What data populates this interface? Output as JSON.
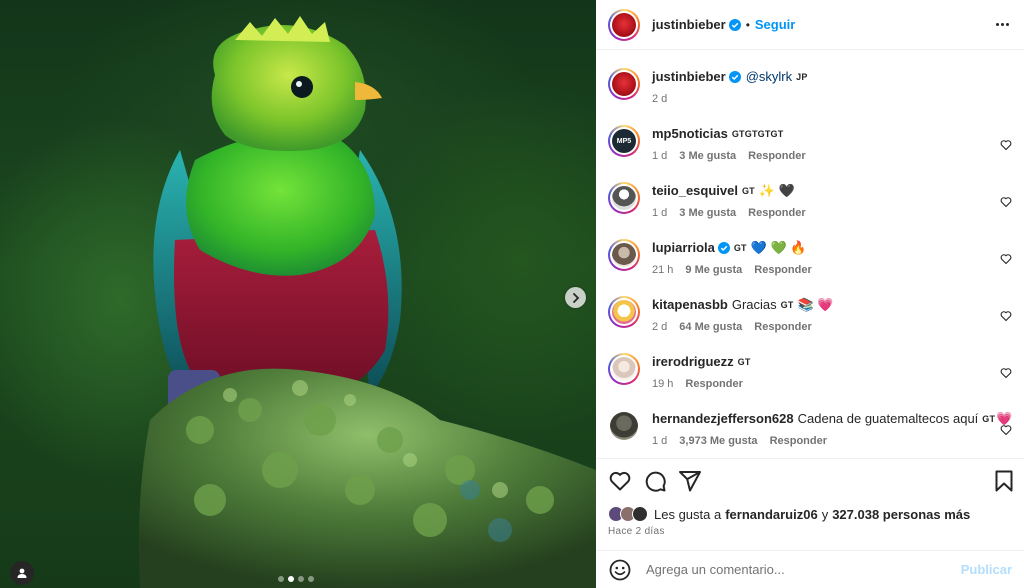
{
  "post": {
    "author": "justinbieber",
    "follow_label": "Seguir",
    "separator": "•",
    "caption_mention": "@skylrk",
    "caption_flag": "JP",
    "caption_time": "2 d"
  },
  "media": {
    "carousel": {
      "slides": 4,
      "active_index": 1
    }
  },
  "comments": [
    {
      "user": "mp5noticias",
      "text": "",
      "flag": "GTGTGTGT",
      "time": "1 d",
      "likes": "3 Me gusta",
      "reply": "Responder",
      "verified": false,
      "avatar": "logo"
    },
    {
      "user": "teiio_esquivel",
      "text": "",
      "flag": "GT",
      "emoji": "✨ 🖤",
      "time": "1 d",
      "likes": "3 Me gusta",
      "reply": "Responder",
      "verified": false,
      "avatar": "person"
    },
    {
      "user": "lupiarriola",
      "text": "",
      "flag": "GT",
      "emoji": "💙 💚 🔥",
      "time": "21 h",
      "likes": "9 Me gusta",
      "reply": "Responder",
      "verified": true,
      "avatar": "person"
    },
    {
      "user": "kitapenasbb",
      "text": "Gracias",
      "flag": "GT",
      "emoji": "📚 💗",
      "time": "2 d",
      "likes": "64 Me gusta",
      "reply": "Responder",
      "verified": false,
      "avatar": "cartoon"
    },
    {
      "user": "irerodriguezz",
      "text": "",
      "flag": "GT",
      "emoji": "",
      "time": "19 h",
      "likes": "",
      "reply": "Responder",
      "verified": false,
      "avatar": "person"
    },
    {
      "user": "hernandezjefferson628",
      "text": "Cadena de guatemaltecos aquí",
      "flag": "GT",
      "emoji": "💗",
      "time": "1 d",
      "likes": "3,973 Me gusta",
      "reply": "Responder",
      "verified": false,
      "avatar": "person"
    }
  ],
  "likes": {
    "prefix": "Les gusta a",
    "user": "fernandaruiz06",
    "middle": "y",
    "others": "327.038 personas más"
  },
  "posted_ago": "Hace 2 días",
  "composer": {
    "placeholder": "Agrega un comentario...",
    "post_label": "Publicar"
  },
  "icons": {
    "header": [
      "verified-badge",
      "more-options"
    ],
    "actions": [
      "heart-icon",
      "comment-icon",
      "share-icon",
      "bookmark-icon"
    ],
    "composer": [
      "emoji-icon"
    ]
  },
  "colors": {
    "link": "#0095f6",
    "muted": "#737373",
    "text": "#262626",
    "post_disabled": "#b2dffc"
  }
}
